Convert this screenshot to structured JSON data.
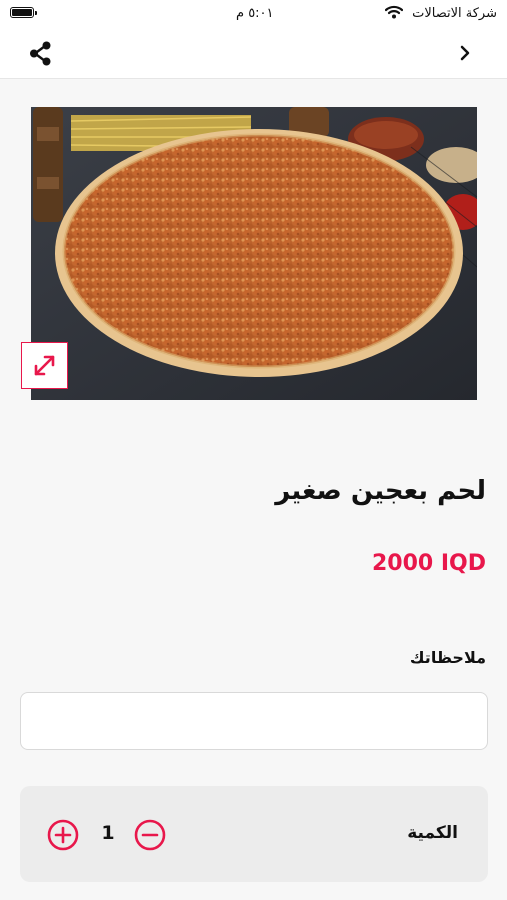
{
  "status_bar": {
    "carrier": "شركة الاتصالات",
    "time": "٥:٠١ م"
  },
  "nav": {
    "back_icon": "chevron-right-icon",
    "share_icon": "share-icon"
  },
  "product": {
    "image_icon": "expand-icon",
    "name": "لحم بعجين صغير",
    "price": "2000 IQD"
  },
  "notes": {
    "label": "ملاحظاتك",
    "value": "",
    "placeholder": ""
  },
  "quantity": {
    "label": "الكمية",
    "value": "1"
  },
  "colors": {
    "accent": "#e8174b",
    "background": "#f7f7f7",
    "card": "#ececec"
  }
}
